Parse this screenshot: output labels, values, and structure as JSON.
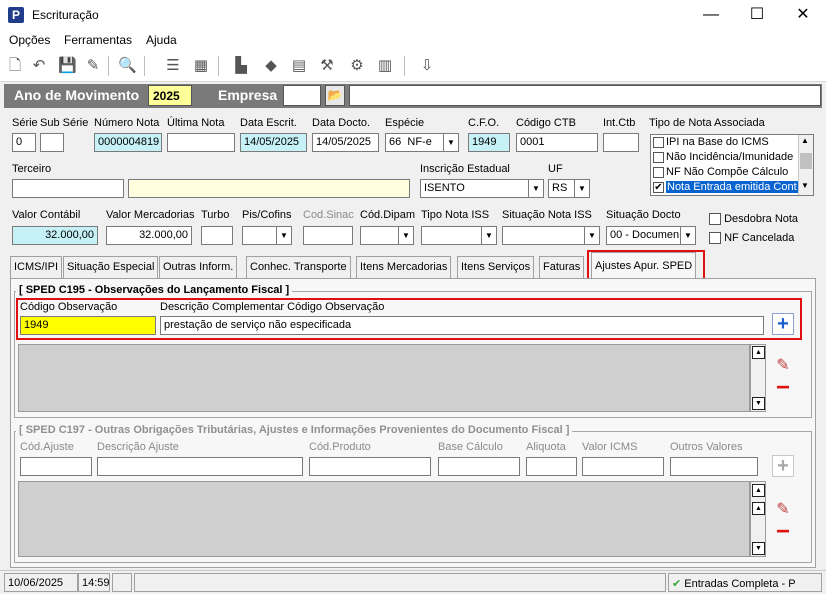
{
  "window": {
    "title": "Escrituração",
    "app_icon_letter": "P",
    "minimize": "—",
    "maximize": "☐",
    "close": "✕"
  },
  "menu": [
    {
      "label": "Opções"
    },
    {
      "label": "Ferramentas"
    },
    {
      "label": "Ajuda"
    }
  ],
  "header": {
    "year_label": "Ano de Movimento",
    "year_value": "2025",
    "company_label": "Empresa",
    "company_code": "",
    "company_name": ""
  },
  "form": {
    "serie": {
      "label": "Série",
      "value": "0"
    },
    "sub_serie": {
      "label": "Sub Série",
      "value": ""
    },
    "numero_nota": {
      "label": "Número Nota",
      "value": "0000004819"
    },
    "ultima_nota": {
      "label": "Última Nota",
      "value": ""
    },
    "data_escrit": {
      "label": "Data Escrit.",
      "value": "14/05/2025"
    },
    "data_docto": {
      "label": "Data Docto.",
      "value": "14/05/2025"
    },
    "especie": {
      "label": "Espécie",
      "code": "66",
      "value": "NF-e"
    },
    "cfo": {
      "label": "C.F.O.",
      "value": "1949"
    },
    "codigo_ctb": {
      "label": "Código CTB",
      "value": "0001"
    },
    "int_ctb": {
      "label": "Int.Ctb",
      "value": ""
    },
    "tipo_nota_associada": {
      "label": "Tipo de Nota Associada",
      "options": [
        {
          "label": "IPI na Base do ICMS",
          "checked": false,
          "selected": false
        },
        {
          "label": "Não Incidência/Imunidade",
          "checked": false,
          "selected": false
        },
        {
          "label": "NF Não Compõe Cálculo",
          "checked": false,
          "selected": false
        },
        {
          "label": "Nota Entrada emitida Cont",
          "checked": true,
          "selected": true
        }
      ]
    },
    "terceiro": {
      "label": "Terceiro",
      "code": "",
      "name": ""
    },
    "inscricao_estadual": {
      "label": "Inscrição Estadual",
      "value": "ISENTO"
    },
    "uf": {
      "label": "UF",
      "value": "RS"
    },
    "valor_contabil": {
      "label": "Valor Contábil",
      "value": "32.000,00"
    },
    "valor_mercadorias": {
      "label": "Valor Mercadorias",
      "value": "32.000,00"
    },
    "turbo": {
      "label": "Turbo",
      "value": ""
    },
    "pis_cofins": {
      "label": "Pis/Cofins",
      "value": ""
    },
    "cod_sinac": {
      "label": "Cod.Sinac",
      "value": ""
    },
    "cod_dipam": {
      "label": "Cód.Dipam",
      "value": ""
    },
    "tipo_nota_iss": {
      "label": "Tipo Nota ISS",
      "value": ""
    },
    "situacao_nota_iss": {
      "label": "Situação Nota ISS",
      "value": ""
    },
    "situacao_docto": {
      "label": "Situação Docto",
      "value": "00 - Documen"
    },
    "desdobra_nota": {
      "label": "Desdobra Nota",
      "checked": false
    },
    "nf_cancelada": {
      "label": "NF Cancelada",
      "checked": false
    }
  },
  "tabs": [
    {
      "label": "ICMS/IPI"
    },
    {
      "label": "Situação Especial"
    },
    {
      "label": "Outras Inform."
    },
    {
      "label": "Conhec. Transporte"
    },
    {
      "label": "Itens Mercadorias"
    },
    {
      "label": "Itens Serviços"
    },
    {
      "label": "Faturas"
    },
    {
      "label": "Ajustes Apur. SPED"
    }
  ],
  "c195": {
    "legend": "[ SPED C195 - Observações do Lançamento Fiscal ]",
    "codigo_label": "Código Observação",
    "descricao_label": "Descrição Complementar Código Observação",
    "codigo_value": "1949",
    "descricao_value": "prestação de serviço não especificada"
  },
  "c197": {
    "legend": "[ SPED C197 - Outras Obrigações Tributárias, Ajustes e Informações Provenientes do Documento Fiscal ]",
    "columns": [
      "Cód.Ajuste",
      "Descrição Ajuste",
      "Cód.Produto",
      "Base Cálculo",
      "Aliquota",
      "Valor ICMS",
      "Outros Valores"
    ]
  },
  "status": {
    "date": "10/06/2025",
    "time": "14:59",
    "message": "Entradas Completa - P"
  },
  "colors": {
    "highlight_red": "#e01010",
    "year_bar": "#7a7a7a",
    "add_blue": "#1a5fd0",
    "remove_red": "#e01010"
  }
}
